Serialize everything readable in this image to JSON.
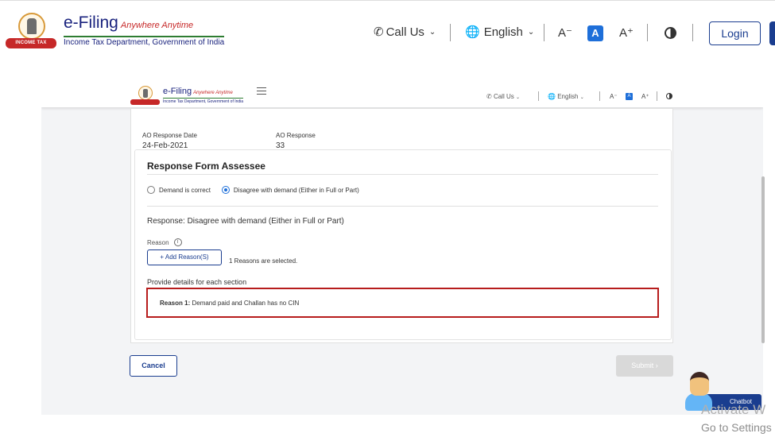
{
  "header": {
    "logo_title": "e-Filing",
    "logo_tag": "Anywhere Anytime",
    "logo_sub": "Income Tax Department, Government of India",
    "emblem_banner": "INCOME TAX DEPARTMENT",
    "call_us": "Call Us",
    "language": "English",
    "font_decrease": "A⁻",
    "font_normal": "A",
    "font_increase": "A⁺",
    "login": "Login"
  },
  "inner": {
    "logo_title": "e-Filing",
    "logo_tag": "Anywhere Anytime",
    "logo_sub": "Income Tax Department, Government of India",
    "call_us": "Call Us",
    "language": "English",
    "font_decrease": "A⁻",
    "font_normal": "A",
    "font_increase": "A⁺",
    "ao_date_label": "AO Response Date",
    "ao_date_value": "24-Feb-2021",
    "ao_response_label": "AO Response",
    "ao_response_value": "33",
    "form_title": "Response Form Assessee",
    "radio_options": [
      "Demand is correct",
      "Disagree with demand (Either in Full or Part)"
    ],
    "response_line": "Response: Disagree with demand (Either in Full or Part)",
    "reason_label": "Reason",
    "info_icon": "i",
    "add_reason": "+ Add Reason(S)",
    "selected_text": "1 Reasons are selected.",
    "details_label": "Provide details for each section",
    "reason_prefix": "Reason 1:",
    "reason_value": "Demand paid and Challan has no CIN",
    "cancel": "Cancel",
    "submit": "Submit ›"
  },
  "chatbot": {
    "label": "Chatbot"
  },
  "watermark": {
    "line1": "Activate W",
    "line2": "Go to Settings"
  },
  "colors": {
    "brand": "#1a3d8f",
    "accent": "#1e6fd9",
    "highlight_border": "#b71c1c"
  }
}
